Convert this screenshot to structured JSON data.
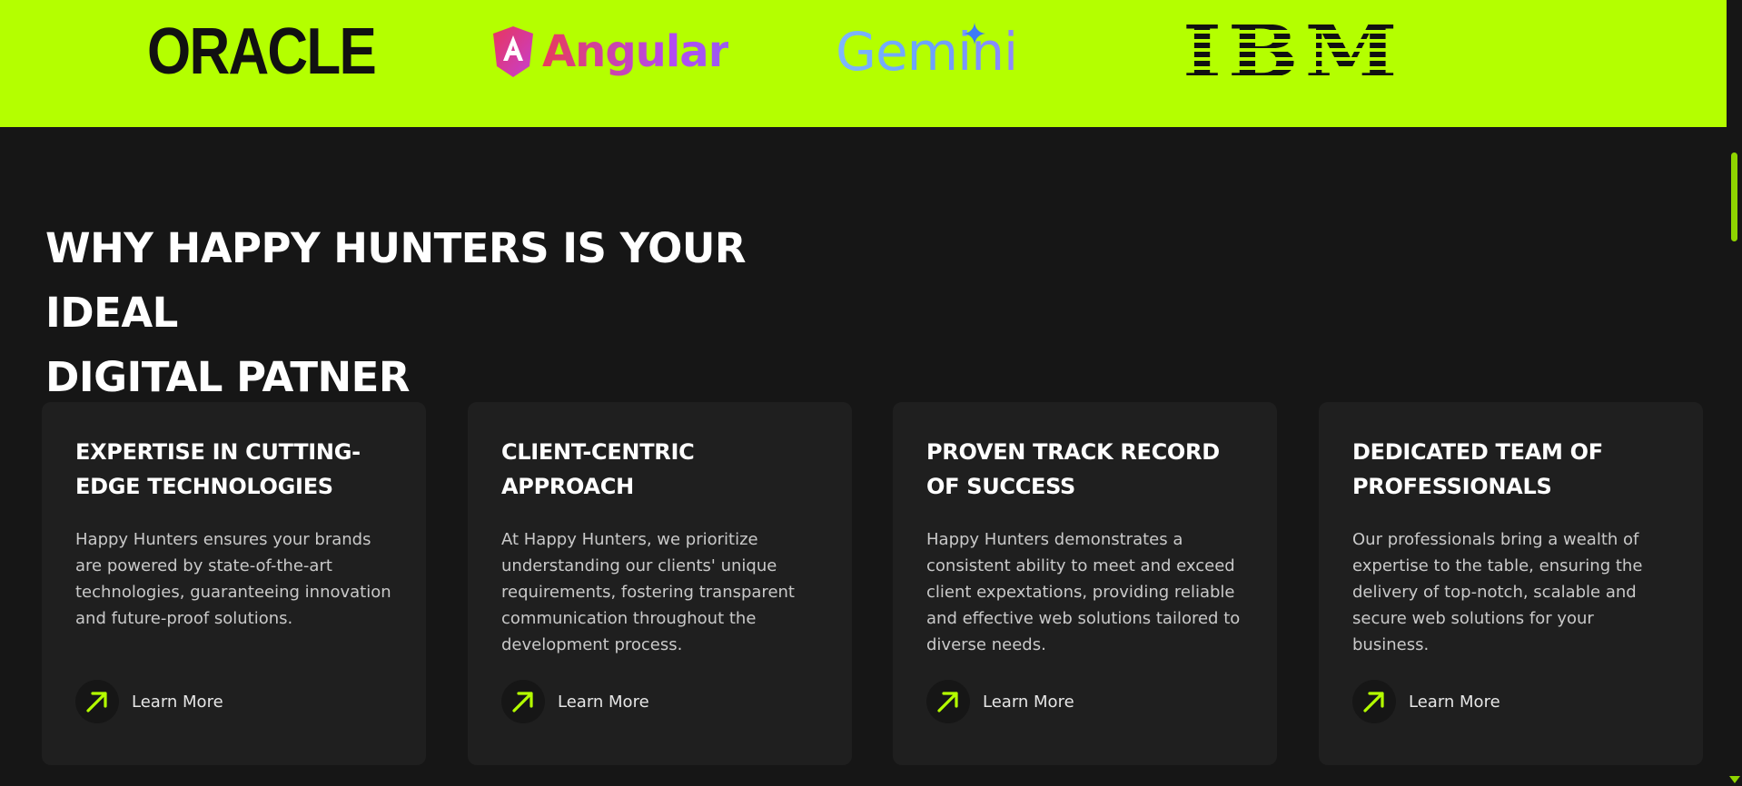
{
  "logos": [
    {
      "name": "ORACLE",
      "label": "ORACLE"
    },
    {
      "name": "Angular",
      "label": "Angular"
    },
    {
      "name": "Gemini",
      "label": "Gemini"
    },
    {
      "name": "IBM",
      "label": "IBM"
    }
  ],
  "colors": {
    "accent": "#b4ff00",
    "background": "#161616",
    "card": "#1f1f1f"
  },
  "section": {
    "title_line1": "WHY HAPPY HUNTERS IS YOUR IDEAL",
    "title_line2": "DIGITAL PATNER"
  },
  "cards": [
    {
      "title": "EXPERTISE IN CUTTING-EDGE TECHNOLOGIES",
      "description": "Happy Hunters ensures your brands are powered by state-of-the-art technologies, guaranteeing innovation and future-proof solutions.",
      "cta": "Learn More",
      "icon": "arrow-up-right-icon"
    },
    {
      "title": "CLIENT-CENTRIC APPROACH",
      "description": "At Happy Hunters, we prioritize understanding our clients' unique requirements, fostering transparent communication throughout the development process.",
      "cta": "Learn More",
      "icon": "arrow-up-right-icon"
    },
    {
      "title": "PROVEN TRACK RECORD OF SUCCESS",
      "description": "Happy Hunters demonstrates a consistent ability to meet and exceed client expextations, providing reliable and effective web solutions tailored to diverse needs.",
      "cta": "Learn More",
      "icon": "arrow-up-right-icon"
    },
    {
      "title": "DEDICATED TEAM OF PROFESSIONALS",
      "description": "Our professionals bring a wealth of expertise to the table, ensuring the delivery of top-notch, scalable and secure web solutions for your business.",
      "cta": "Learn More",
      "icon": "arrow-up-right-icon"
    }
  ]
}
